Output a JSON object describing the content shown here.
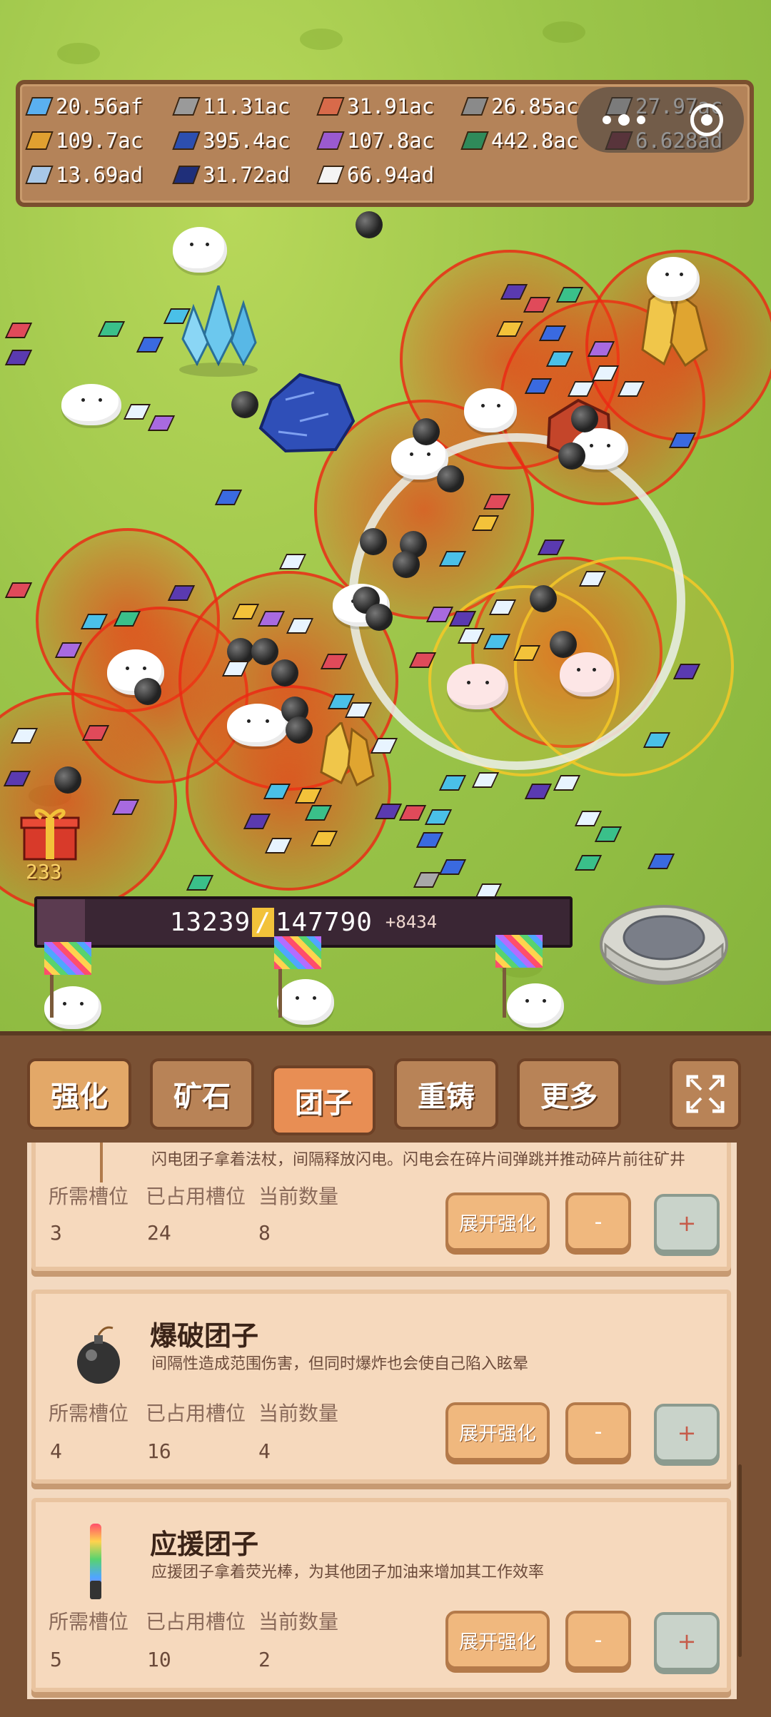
{
  "resources": [
    {
      "value": "20.56af",
      "color": "#5ab0f0",
      "icon": "diamond-gem-icon"
    },
    {
      "value": "11.31ac",
      "color": "#9a9a9a",
      "icon": "stone-ingot-icon"
    },
    {
      "value": "31.91ac",
      "color": "#d86a4a",
      "icon": "copper-ingot-icon"
    },
    {
      "value": "26.85ac",
      "color": "#8a8a8a",
      "icon": "iron-ingot-icon"
    },
    {
      "value": "27.97ac",
      "color": "#c8c8c8",
      "icon": "silver-ingot-icon"
    },
    {
      "value": "109.7ac",
      "color": "#e0a030",
      "icon": "gold-ingot-icon"
    },
    {
      "value": "395.4ac",
      "color": "#2d4fb0",
      "icon": "sapphire-ingot-icon"
    },
    {
      "value": "107.8ac",
      "color": "#9a5ad0",
      "icon": "amethyst-ingot-icon"
    },
    {
      "value": "442.8ac",
      "color": "#2f8a5a",
      "icon": "emerald-ingot-icon"
    },
    {
      "value": "6.628ad",
      "color": "#7a2a3a",
      "icon": "ruby-ingot-icon"
    },
    {
      "value": "13.69ad",
      "color": "#a8c8e8",
      "icon": "crystal-ingot-icon"
    },
    {
      "value": "31.72ad",
      "color": "#1f2f7a",
      "icon": "lapis-ingot-icon"
    },
    {
      "value": "66.94ad",
      "color": "#f4f4f4",
      "icon": "white-gem-icon"
    }
  ],
  "progress": {
    "current": "13239",
    "slash": "/",
    "total": "147790",
    "increment": "+8434",
    "fraction": 0.09
  },
  "gift": {
    "count": "233"
  },
  "tabs": {
    "strengthen": "强化",
    "ore": "矿石",
    "dango": "团子",
    "recast": "重铸",
    "more": "更多",
    "expand_icon": "fullscreen-icon"
  },
  "cards": [
    {
      "desc": "闪电团子拿着法杖，间隔释放闪电。闪电会在碎片间弹跳并推动碎片前往矿井",
      "labels": {
        "required": "所需槽位",
        "occupied": "已占用槽位",
        "count": "当前数量"
      },
      "values": {
        "required": "3",
        "occupied": "24",
        "count": "8"
      },
      "expand": "展开强化",
      "minus": "-",
      "plus": "+"
    },
    {
      "title": "爆破团子",
      "desc": "间隔性造成范围伤害，但同时爆炸也会使自己陷入眩晕",
      "labels": {
        "required": "所需槽位",
        "occupied": "已占用槽位",
        "count": "当前数量"
      },
      "values": {
        "required": "4",
        "occupied": "16",
        "count": "4"
      },
      "expand": "展开强化",
      "minus": "-",
      "plus": "+"
    },
    {
      "title": "应援团子",
      "desc": "应援团子拿着荧光棒，为其他团子加油来增加其工作效率",
      "labels": {
        "required": "所需槽位",
        "occupied": "已占用槽位",
        "count": "当前数量"
      },
      "values": {
        "required": "5",
        "occupied": "10",
        "count": "2"
      },
      "expand": "展开强化",
      "minus": "-",
      "plus": "+"
    }
  ]
}
